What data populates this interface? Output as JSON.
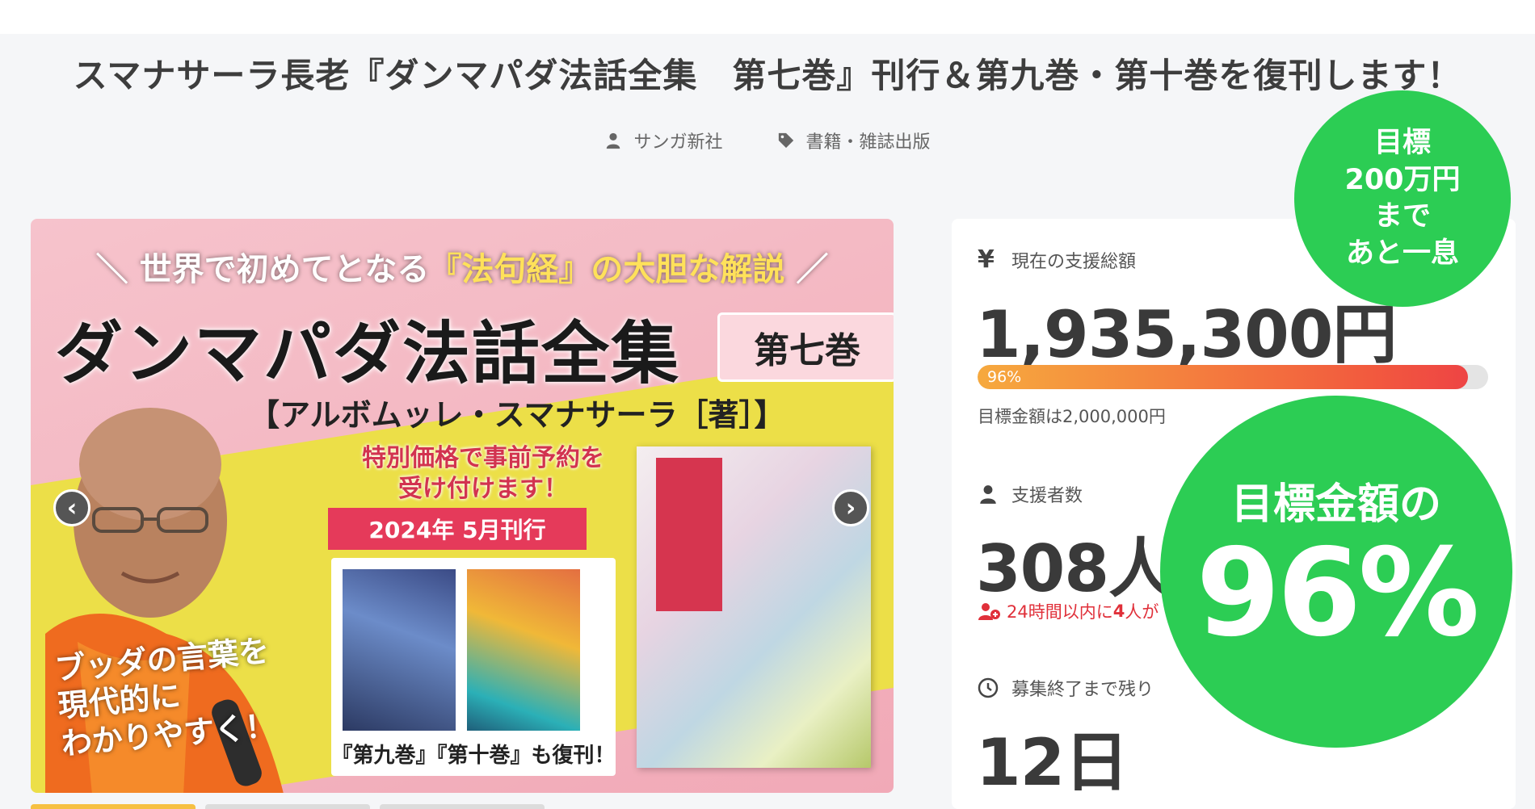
{
  "project": {
    "title": "スマナサーラ長老『ダンマパダ法話全集　第七巻』刊行＆第九巻・第十巻を復刊します！",
    "owner": "サンガ新社",
    "category": "書籍・雑誌出版",
    "owner_icon": "user-icon",
    "category_icon": "tag-icon"
  },
  "visual": {
    "banner_prefix": "＼ 世界で初めてとなる",
    "banner_highlight": "『法句経』の大胆な解説",
    "banner_suffix": " ／",
    "book_title": "ダンマパダ法話全集",
    "volume": "第七巻",
    "author": "【アルボムッレ・スマナサーラ［著］】",
    "prebook_line1": "特別価格で事前予約を",
    "prebook_line2": "受け付けます！",
    "release": "2024年 5月刊行",
    "reissue": "『第九巻』『第十巻』も復刊！",
    "slogan_line1": "ブッダの言葉を",
    "slogan_line2": "現代的に",
    "slogan_line3": "わかりやすく！",
    "prev_icon": "chevron-left-icon",
    "next_icon": "chevron-right-icon",
    "prev_symbol": "‹",
    "next_symbol": "›"
  },
  "thumbnails": [
    {
      "color": "#f6c042"
    },
    {
      "color": "#dcdcdc"
    },
    {
      "color": "#dcdcdc"
    }
  ],
  "stats": {
    "total_label": "現在の支援総額",
    "total_icon": "yen-icon",
    "total_symbol": "¥",
    "total_value": "1,935,300円",
    "progress_percent": 96,
    "progress_label": "96%",
    "goal_text": "目標金額は2,000,000円",
    "supporters_label": "支援者数",
    "supporters_icon": "user-icon",
    "supporters_value": "308人",
    "recent_prefix": "24時間以内に",
    "recent_count": "4",
    "recent_suffix": "人が",
    "recent_icon": "user-plus-icon",
    "remaining_label": "募集終了まで残り",
    "remaining_icon": "clock-icon",
    "remaining_value": "12日"
  },
  "badges": {
    "small_line1": "目標",
    "small_line2": "200万円",
    "small_line3": "まで",
    "small_line4": "あと一息",
    "big_line1": "目標金額の",
    "big_line2": "96%"
  },
  "colors": {
    "accent_green": "#2ccd54",
    "progress_start": "#f6a93e",
    "progress_end": "#ee4444",
    "alert_red": "#e0303a"
  }
}
